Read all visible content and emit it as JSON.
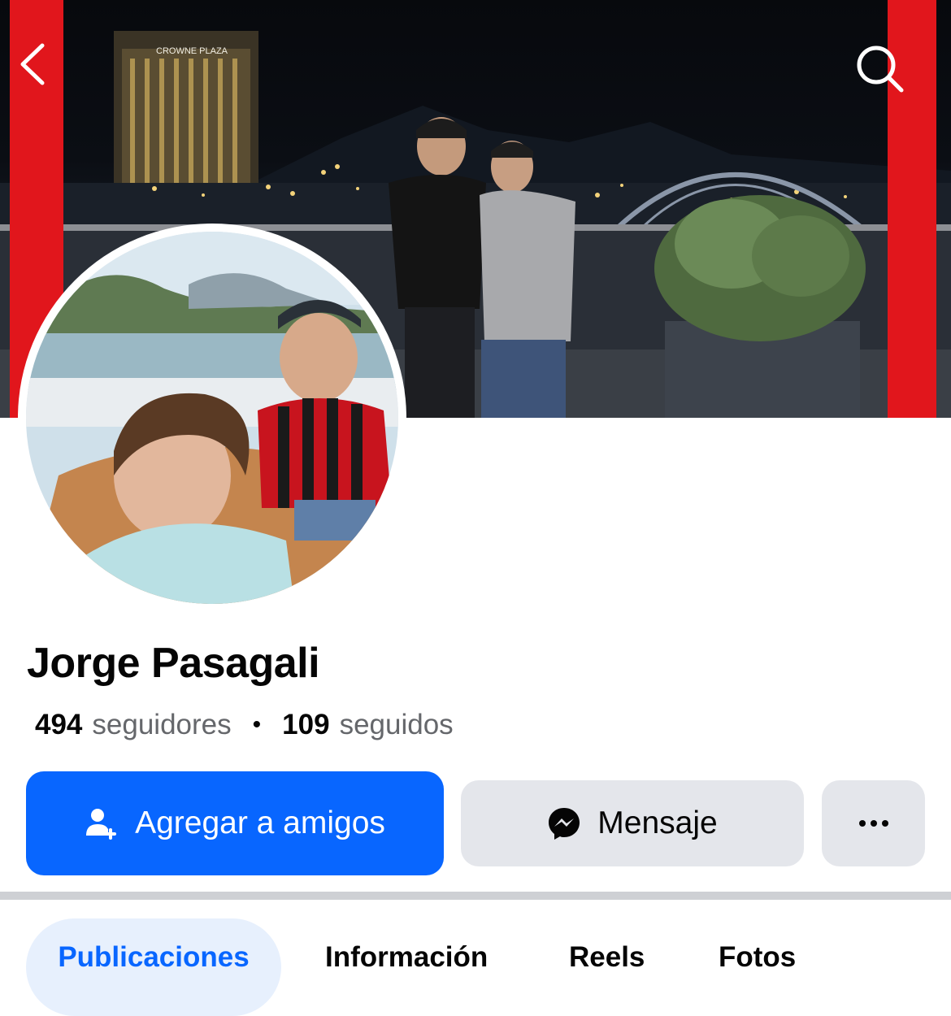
{
  "nav": {
    "back_icon": "chevron-left-icon",
    "search_icon": "search-icon"
  },
  "cover": {
    "sign_text": "CROWNE PLAZA"
  },
  "profile": {
    "name": "Jorge Pasagali",
    "followers_count": "494",
    "followers_label": "seguidores",
    "separator": "•",
    "following_count": "109",
    "following_label": "seguidos"
  },
  "actions": {
    "add_friend_label": "Agregar a amigos",
    "add_friend_icon": "add-friend-icon",
    "message_label": "Mensaje",
    "message_icon": "messenger-icon",
    "more_label": "···",
    "primary_color": "#0866ff",
    "secondary_color": "#e4e6eb"
  },
  "tabs": [
    {
      "label": "Publicaciones",
      "active": true
    },
    {
      "label": "Información",
      "active": false
    },
    {
      "label": "Reels",
      "active": false
    },
    {
      "label": "Fotos",
      "active": false
    }
  ]
}
